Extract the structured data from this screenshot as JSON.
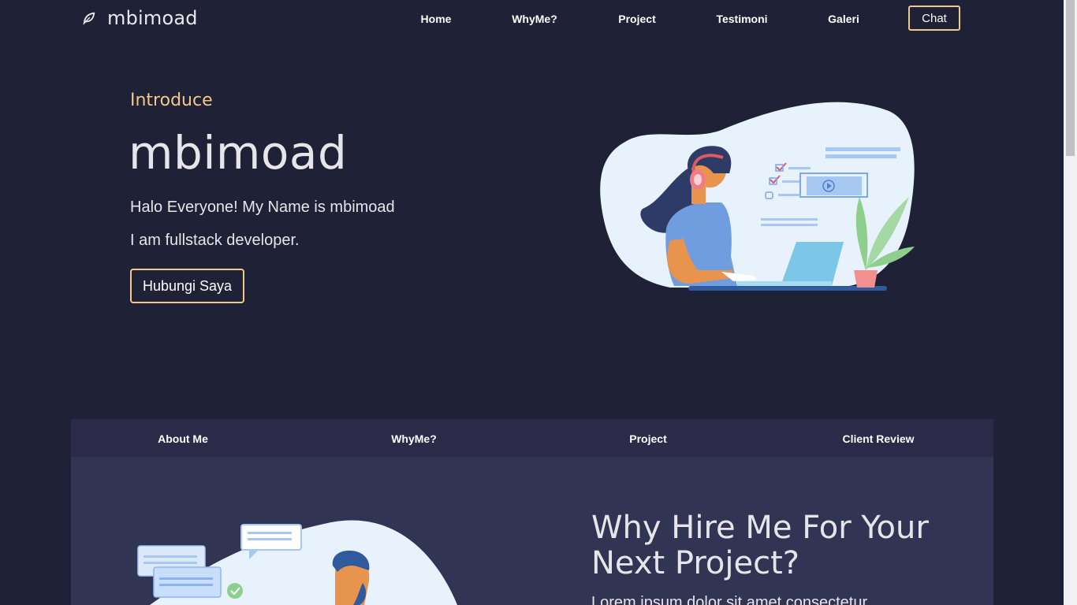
{
  "brand": {
    "name": "mbimoad",
    "icon": "leaf-icon"
  },
  "nav": {
    "links": [
      "Home",
      "WhyMe?",
      "Project",
      "Testimoni",
      "Galeri"
    ],
    "chat_label": "Chat"
  },
  "hero": {
    "label": "Introduce",
    "title": "mbimoad",
    "line1": "Halo Everyone! My Name is mbimoad",
    "line2": "I am fullstack developer.",
    "button_label": "Hubungi Saya",
    "illustration": "developer-with-headset-illustration"
  },
  "section_tabs": [
    "About Me",
    "WhyMe?",
    "Project",
    "Client Review"
  ],
  "why": {
    "title": "Why Hire Me For Your Next Project?",
    "text": "Lorem ipsum dolor sit amet consectetur"
  },
  "colors": {
    "background": "#1f2136",
    "accent": "#f2c98a",
    "tab_bar": "#2b2a48",
    "panel": "#313553"
  }
}
